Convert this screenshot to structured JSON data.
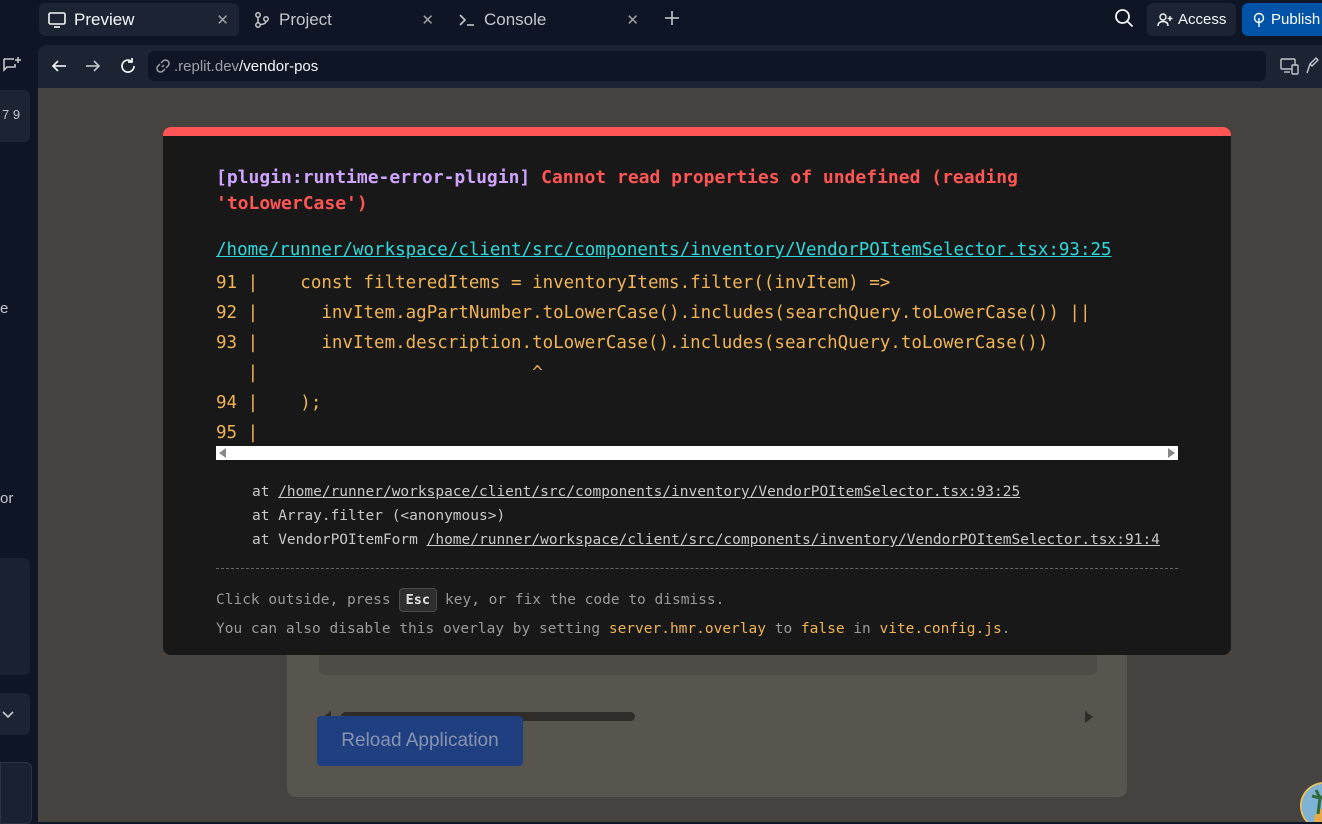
{
  "tabs": [
    {
      "label": "Preview",
      "icon": "monitor-icon",
      "active": true
    },
    {
      "label": "Project",
      "icon": "git-branch-icon",
      "active": false
    },
    {
      "label": "Console",
      "icon": "terminal-icon",
      "active": false
    }
  ],
  "header": {
    "access_label": "Access",
    "publish_label": "Publish"
  },
  "sidebar": {
    "fragments": [
      "7 9",
      "e",
      "or"
    ]
  },
  "address": {
    "url_prefix": ".replit.dev",
    "url_path": "/vendor-pos"
  },
  "app": {
    "reload_label": "Reload Application"
  },
  "error_overlay": {
    "plugin": "[plugin:runtime-error-plugin]",
    "message": "Cannot read properties of undefined (reading 'toLowerCase')",
    "file": "/home/runner/workspace/client/src/components/inventory/VendorPOItemSelector.tsx:93:25",
    "code_lines": [
      "91 |    const filteredItems = inventoryItems.filter((invItem) =>",
      "92 |      invItem.agPartNumber.toLowerCase().includes(searchQuery.toLowerCase()) ||",
      "93 |      invItem.description.toLowerCase().includes(searchQuery.toLowerCase())",
      "   |                          ^",
      "94 |    );",
      "95 |"
    ],
    "stack": [
      {
        "prefix": "at ",
        "text": "/home/runner/workspace/client/src/components/inventory/VendorPOItemSelector.tsx:93:25",
        "link": true
      },
      {
        "prefix": "at ",
        "text": "Array.filter (<anonymous>)",
        "link": false
      },
      {
        "prefix": "at VendorPOItemForm ",
        "text": "/home/runner/workspace/client/src/components/inventory/VendorPOItemSelector.tsx:91:4",
        "link": true
      }
    ],
    "tip1_before": "Click outside, press",
    "tip1_key": "Esc",
    "tip1_after": "key, or fix the code to dismiss.",
    "tip2_a": "You can also disable this overlay by setting ",
    "tip2_setting": "server.hmr.overlay",
    "tip2_b": " to ",
    "tip2_value": "false",
    "tip2_c": " in ",
    "tip2_file": "vite.config.js",
    "tip2_d": "."
  },
  "colors": {
    "error_red": "#ff5555",
    "plugin_purple": "#cfa4ff",
    "file_cyan": "#2dd9da",
    "code_amber": "#f0b454",
    "publish_blue": "#0053a6"
  }
}
